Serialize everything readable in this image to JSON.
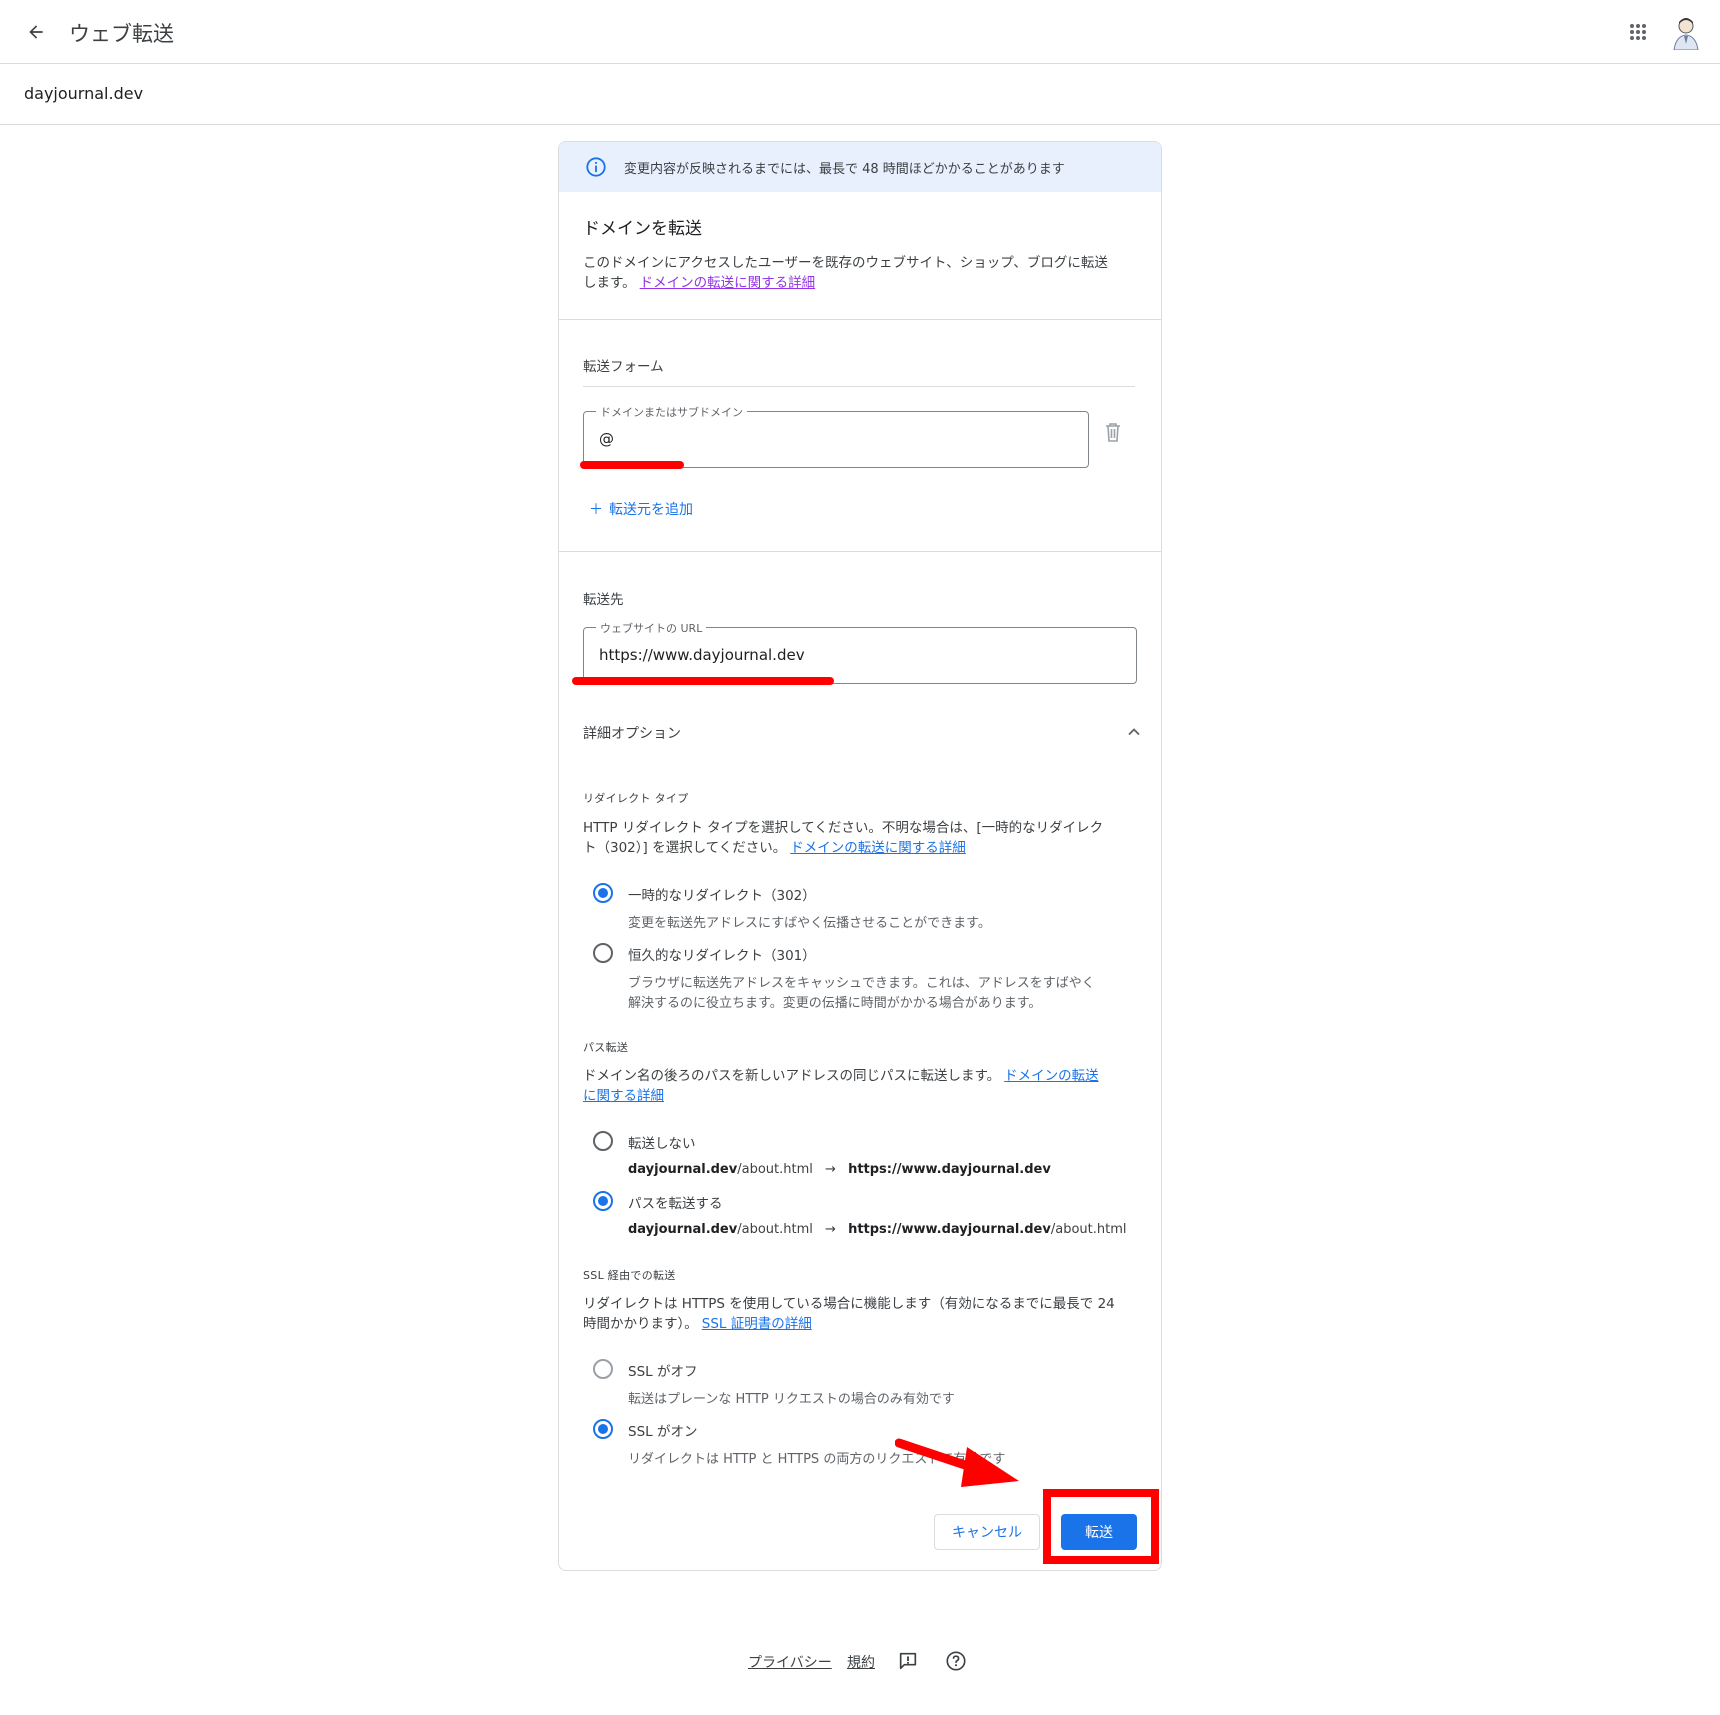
{
  "header": {
    "title": "ウェブ転送",
    "back_icon": "arrow-back-icon",
    "apps_icon": "apps-grid-icon",
    "avatar_icon": "user-avatar"
  },
  "domain": "dayjournal.dev",
  "banner": {
    "text": "変更内容が反映されるまでには、最長で 48 時間ほどかかることがあります",
    "icon": "info-icon"
  },
  "section_forward": {
    "title": "ドメインを転送",
    "desc_line1": "このドメインにアクセスしたユーザーを既存のウェブサイト、ショップ、ブログに転送",
    "desc_line2": "します。",
    "link": "ドメインの転送に関する詳細"
  },
  "form": {
    "title": "転送フォーム",
    "source_label": "ドメインまたはサブドメイン",
    "source_value": "@",
    "add_source": "転送元を追加",
    "delete_icon": "trash-icon"
  },
  "destination": {
    "title": "転送先",
    "url_label": "ウェブサイトの URL",
    "url_value": "https://www.dayjournal.dev"
  },
  "advanced": {
    "title": "詳細オプション",
    "chevron_icon": "chevron-up-icon",
    "redirect_type": {
      "title": "リダイレクト タイプ",
      "desc_line1": "HTTP リダイレクト タイプを選択してください。不明な場合は、[一時的なリダイレク",
      "desc_line2": "ト（302）] を選択してください。",
      "link": "ドメインの転送に関する詳細",
      "options": [
        {
          "label": "一時的なリダイレクト（302）",
          "desc": "変更を転送先アドレスにすばやく伝播させることができます。",
          "checked": true
        },
        {
          "label": "恒久的なリダイレクト（301）",
          "desc_line1": "ブラウザに転送先アドレスをキャッシュできます。これは、アドレスをすばやく",
          "desc_line2": "解決するのに役立ちます。変更の伝播に時間がかかる場合があります。",
          "checked": false
        }
      ]
    },
    "path_forwarding": {
      "title": "パス転送",
      "desc_line1": "ドメイン名の後ろのパスを新しいアドレスの同じパスに転送します。",
      "link_line1": "ドメインの転送",
      "link_line2": "に関する詳細",
      "options": [
        {
          "label": "転送しない",
          "ex_domain": "dayjournal.dev",
          "ex_path": "/about.html",
          "ex_target": "https://www.dayjournal.dev",
          "ex_target_path": "",
          "checked": false
        },
        {
          "label": "パスを転送する",
          "ex_domain": "dayjournal.dev",
          "ex_path": "/about.html",
          "ex_target": "https://www.dayjournal.dev",
          "ex_target_path": "/about.html",
          "checked": true
        }
      ]
    },
    "ssl": {
      "title": "SSL 経由での転送",
      "desc_line1": "リダイレクトは HTTPS を使用している場合に機能します（有効になるまでに最長で 24",
      "desc_line2": "時間かかります）。",
      "link": "SSL 証明書の詳細",
      "options": [
        {
          "label": "SSL がオフ",
          "desc": "転送はプレーンな HTTP リクエストの場合のみ有効です",
          "checked": false
        },
        {
          "label": "SSL がオン",
          "desc": "リダイレクトは HTTP と HTTPS の両方のリクエストで有効です",
          "checked": true
        }
      ]
    }
  },
  "actions": {
    "cancel": "キャンセル",
    "submit": "転送"
  },
  "footer": {
    "privacy": "プライバシー",
    "terms": "規約",
    "feedback_icon": "feedback-icon",
    "help_icon": "help-icon"
  },
  "colors": {
    "accent": "#1a73e8",
    "annotation": "#ff0000",
    "banner_bg": "#e8f0fe"
  }
}
